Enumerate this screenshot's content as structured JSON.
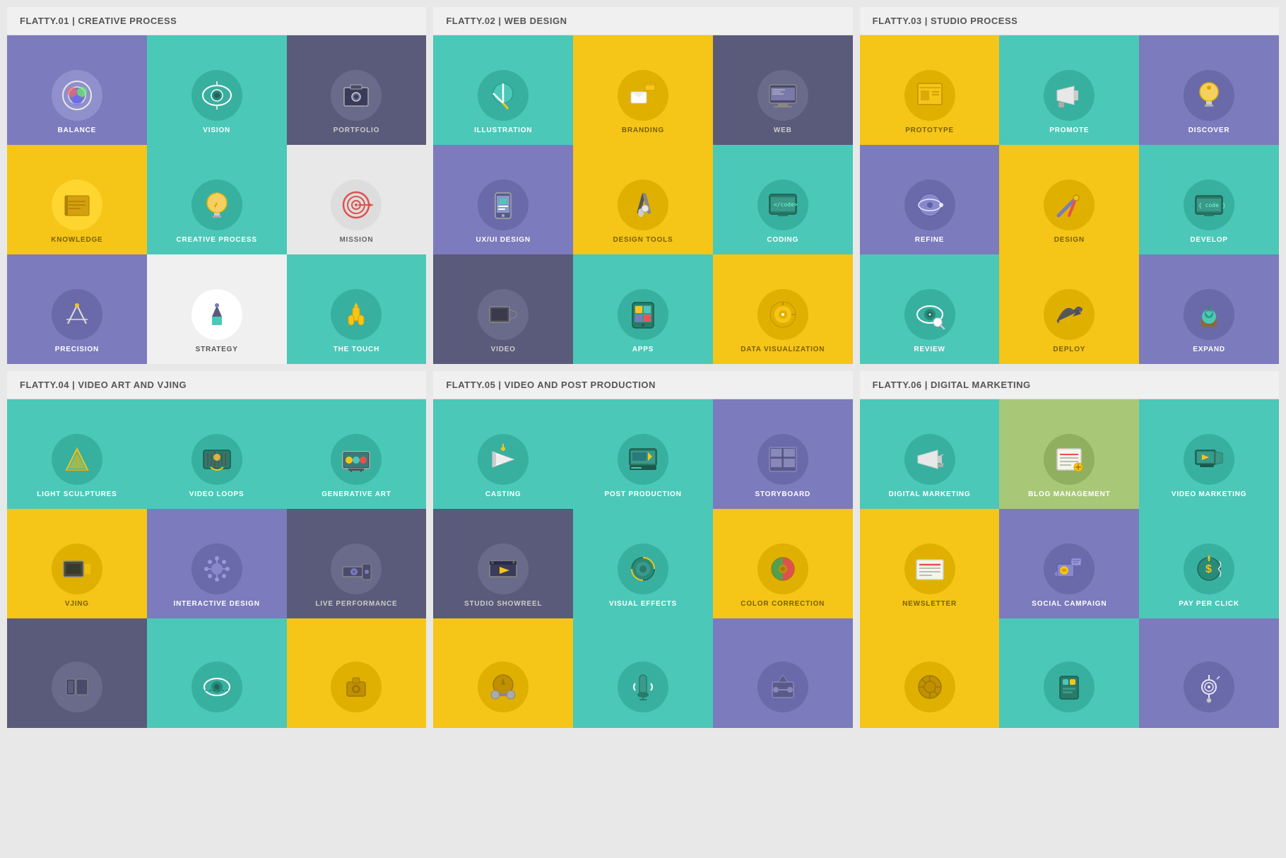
{
  "panels": [
    {
      "id": "panel-1",
      "title": "FLATTY.01 | CREATIVE PROCESS",
      "icons": [
        {
          "label": "BALANCE",
          "bg": "#7b7bbd",
          "circle": "#9090cc",
          "symbol": "⊕",
          "labelColor": "#fff"
        },
        {
          "label": "VISION",
          "bg": "#4bc8b8",
          "circle": "#5ad8c8",
          "symbol": "👁",
          "labelColor": "#fff"
        },
        {
          "label": "PORTFOLIO",
          "bg": "#5a5a7a",
          "circle": "#6a6a8a",
          "symbol": "📷",
          "labelColor": "#fff"
        },
        {
          "label": "KNOWLEDGE",
          "bg": "#f5c518",
          "circle": "#ffd530",
          "symbol": "📖",
          "labelColor": "#555"
        },
        {
          "label": "CREATIVE PROCESS",
          "bg": "#4bc8b8",
          "circle": "#38b0a0",
          "symbol": "💡",
          "labelColor": "#fff"
        },
        {
          "label": "MISSION",
          "bg": "#e8e8e8",
          "circle": "#ddd",
          "symbol": "🎯",
          "labelColor": "#555"
        },
        {
          "label": "PRECISION",
          "bg": "#7b7bbd",
          "circle": "#6a6aaa",
          "symbol": "✏",
          "labelColor": "#fff"
        },
        {
          "label": "STRATEGY",
          "bg": "#f0f0f0",
          "circle": "#fff",
          "symbol": "♟",
          "labelColor": "#555"
        },
        {
          "label": "THE TOUCH",
          "bg": "#4bc8b8",
          "circle": "#38b0a0",
          "symbol": "☝",
          "labelColor": "#fff"
        }
      ]
    },
    {
      "id": "panel-2",
      "title": "FLATTY.02 | WEB DESIGN",
      "icons": [
        {
          "label": "ILLUSTRATION",
          "bg": "#4bc8b8",
          "circle": "#38b0a0",
          "symbol": "✏",
          "labelColor": "#fff"
        },
        {
          "label": "BRANDING",
          "bg": "#f5c518",
          "circle": "#e0b000",
          "symbol": "✉",
          "labelColor": "#555"
        },
        {
          "label": "WEB",
          "bg": "#5a5a7a",
          "circle": "#6a6a8a",
          "symbol": "🖥",
          "labelColor": "#fff"
        },
        {
          "label": "UX/UI DESIGN",
          "bg": "#7b7bbd",
          "circle": "#6a6aaa",
          "symbol": "📱",
          "labelColor": "#fff"
        },
        {
          "label": "DESIGN TOOLS",
          "bg": "#f5c518",
          "circle": "#e0b000",
          "symbol": "✏",
          "labelColor": "#555"
        },
        {
          "label": "CODING",
          "bg": "#4bc8b8",
          "circle": "#38b0a0",
          "symbol": "💻",
          "labelColor": "#fff"
        },
        {
          "label": "VIDEO",
          "bg": "#5a5a7a",
          "circle": "#6a6a8a",
          "symbol": "📺",
          "labelColor": "#fff"
        },
        {
          "label": "APPS",
          "bg": "#4bc8b8",
          "circle": "#38b0a0",
          "symbol": "📱",
          "labelColor": "#fff"
        },
        {
          "label": "DATA VISUALIZATION",
          "bg": "#f5c518",
          "circle": "#e0b000",
          "symbol": "📊",
          "labelColor": "#555"
        }
      ]
    },
    {
      "id": "panel-3",
      "title": "FLATTY.03 | STUDIO PROCESS",
      "icons": [
        {
          "label": "PROTOTYPE",
          "bg": "#f5c518",
          "circle": "#e0b000",
          "symbol": "📐",
          "labelColor": "#555"
        },
        {
          "label": "PROMOTE",
          "bg": "#4bc8b8",
          "circle": "#38b0a0",
          "symbol": "📢",
          "labelColor": "#fff"
        },
        {
          "label": "DISCOVER",
          "bg": "#7b7bbd",
          "circle": "#6a6aaa",
          "symbol": "💡",
          "labelColor": "#fff"
        },
        {
          "label": "REFINE",
          "bg": "#7b7bbd",
          "circle": "#6a6aaa",
          "symbol": "🔧",
          "labelColor": "#fff"
        },
        {
          "label": "DESIGN",
          "bg": "#f5c518",
          "circle": "#e0b000",
          "symbol": "✏",
          "labelColor": "#555"
        },
        {
          "label": "DEVELOP",
          "bg": "#4bc8b8",
          "circle": "#38b0a0",
          "symbol": "🖥",
          "labelColor": "#fff"
        },
        {
          "label": "REVIEW",
          "bg": "#4bc8b8",
          "circle": "#38b0a0",
          "symbol": "🔍",
          "labelColor": "#fff"
        },
        {
          "label": "DEPLOY",
          "bg": "#f5c518",
          "circle": "#e0b000",
          "symbol": "✈",
          "labelColor": "#555"
        },
        {
          "label": "EXPAND",
          "bg": "#7b7bbd",
          "circle": "#6a6aaa",
          "symbol": "🌳",
          "labelColor": "#fff"
        }
      ]
    },
    {
      "id": "panel-4",
      "title": "FLATTY.04 | VIDEO ART AND VJING",
      "icons": [
        {
          "label": "LIGHT SCULPTURES",
          "bg": "#4bc8b8",
          "circle": "#38b0a0",
          "symbol": "△",
          "labelColor": "#fff"
        },
        {
          "label": "VIDEO LOOPS",
          "bg": "#4bc8b8",
          "circle": "#38b0a0",
          "symbol": "∞",
          "labelColor": "#fff"
        },
        {
          "label": "GENERATIVE ART",
          "bg": "#4bc8b8",
          "circle": "#38b0a0",
          "symbol": "🎛",
          "labelColor": "#fff"
        },
        {
          "label": "VJING",
          "bg": "#f5c518",
          "circle": "#e0b000",
          "symbol": "📺",
          "labelColor": "#555"
        },
        {
          "label": "INTERACTIVE DESIGN",
          "bg": "#7b7bbd",
          "circle": "#6a6aaa",
          "symbol": "⚙",
          "labelColor": "#fff"
        },
        {
          "label": "LIVE PERFORMANCE",
          "bg": "#5a5a7a",
          "circle": "#6a6a8a",
          "symbol": "📽",
          "labelColor": "#fff"
        },
        {
          "label": "",
          "bg": "#5a5a7a",
          "circle": "#6a6a8a",
          "symbol": "📦",
          "labelColor": "#fff"
        },
        {
          "label": "",
          "bg": "#4bc8b8",
          "circle": "#38b0a0",
          "symbol": "👁",
          "labelColor": "#fff"
        },
        {
          "label": "",
          "bg": "#f5c518",
          "circle": "#e0b000",
          "symbol": "📷",
          "labelColor": "#555"
        }
      ]
    },
    {
      "id": "panel-5",
      "title": "FLATTY.05 | VIDEO AND POST PRODUCTION",
      "icons": [
        {
          "label": "CASTING",
          "bg": "#4bc8b8",
          "circle": "#38b0a0",
          "symbol": "🎬",
          "labelColor": "#fff"
        },
        {
          "label": "POST PRODUCTION",
          "bg": "#4bc8b8",
          "circle": "#38b0a0",
          "symbol": "🖥",
          "labelColor": "#fff"
        },
        {
          "label": "STORYBOARD",
          "bg": "#7b7bbd",
          "circle": "#6a6aaa",
          "symbol": "📋",
          "labelColor": "#fff"
        },
        {
          "label": "STUDIO SHOWREEL",
          "bg": "#5a5a7a",
          "circle": "#6a6a8a",
          "symbol": "🎬",
          "labelColor": "#fff"
        },
        {
          "label": "VISUAL EFFECTS",
          "bg": "#4bc8b8",
          "circle": "#38b0a0",
          "symbol": "✨",
          "labelColor": "#fff"
        },
        {
          "label": "COLOR CORRECTION",
          "bg": "#f5c518",
          "circle": "#e0b000",
          "symbol": "🎨",
          "labelColor": "#555"
        },
        {
          "label": "",
          "bg": "#f5c518",
          "circle": "#e0b000",
          "symbol": "🎥",
          "labelColor": "#555"
        },
        {
          "label": "",
          "bg": "#4bc8b8",
          "circle": "#38b0a0",
          "symbol": "🎤",
          "labelColor": "#fff"
        },
        {
          "label": "",
          "bg": "#7b7bbd",
          "circle": "#6a6aaa",
          "symbol": "💡",
          "labelColor": "#fff"
        }
      ]
    },
    {
      "id": "panel-6",
      "title": "FLATTY.06 | DIGITAL MARKETING",
      "icons": [
        {
          "label": "DIGITAL MARKETING",
          "bg": "#4bc8b8",
          "circle": "#38b0a0",
          "symbol": "📢",
          "labelColor": "#fff"
        },
        {
          "label": "BLOG MANAGEMENT",
          "bg": "#a8c878",
          "circle": "#90b060",
          "symbol": "📝",
          "labelColor": "#fff"
        },
        {
          "label": "VIDEO MARKETING",
          "bg": "#4bc8b8",
          "circle": "#38b0a0",
          "symbol": "📱",
          "labelColor": "#fff"
        },
        {
          "label": "NEWSLETTER",
          "bg": "#f5c518",
          "circle": "#e0b000",
          "symbol": "📰",
          "labelColor": "#555"
        },
        {
          "label": "SOCIAL CAMPAIGN",
          "bg": "#7b7bbd",
          "circle": "#6a6aaa",
          "symbol": "👍",
          "labelColor": "#fff"
        },
        {
          "label": "PAY PER CLICK",
          "bg": "#4bc8b8",
          "circle": "#38b0a0",
          "symbol": "$",
          "labelColor": "#fff"
        },
        {
          "label": "",
          "bg": "#f5c518",
          "circle": "#e0b000",
          "symbol": "⚙",
          "labelColor": "#555"
        },
        {
          "label": "",
          "bg": "#4bc8b8",
          "circle": "#38b0a0",
          "symbol": "🏪",
          "labelColor": "#fff"
        },
        {
          "label": "",
          "bg": "#7b7bbd",
          "circle": "#6a6aaa",
          "symbol": "🔍",
          "labelColor": "#fff"
        }
      ]
    }
  ],
  "colors": {
    "teal": "#4bc8b8",
    "yellow": "#f5c518",
    "purple": "#7b7bbd",
    "dark": "#5a5a7a",
    "green": "#a8c878",
    "white": "#ffffff",
    "bg": "#e8e8e8"
  }
}
